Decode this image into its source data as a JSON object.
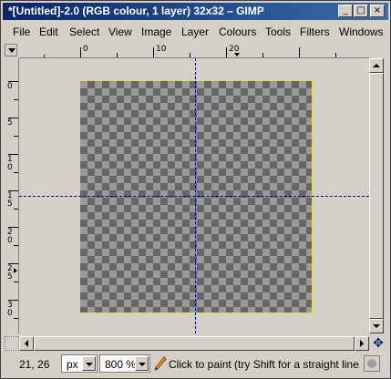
{
  "window": {
    "title": "*[Untitled]-2.0 (RGB colour, 1 layer) 32x32 – GIMP",
    "controls": {
      "minimize": "_",
      "maximize": "□",
      "close": "×"
    }
  },
  "menubar": {
    "items": [
      {
        "label": "File"
      },
      {
        "label": "Edit"
      },
      {
        "label": "Select"
      },
      {
        "label": "View"
      },
      {
        "label": "Image"
      },
      {
        "label": "Layer"
      },
      {
        "label": "Colours"
      },
      {
        "label": "Tools"
      },
      {
        "label": "Filters"
      },
      {
        "label": "Windows"
      }
    ]
  },
  "rulers": {
    "horizontal": [
      "0",
      "10",
      "20"
    ],
    "vertical": [
      "0",
      "5",
      "10",
      "15",
      "20",
      "25",
      "30"
    ]
  },
  "statusbar": {
    "coords": "21, 26",
    "unit": "px",
    "zoom": "800 %",
    "hint": "Click to paint (try Shift for a straight line, ..."
  },
  "icons": {
    "corner": "chevron-down-icon",
    "quickmask": "quick-mask-icon",
    "navigate": "navigate-icon",
    "tool": "pencil-icon",
    "cancel": "cancel-icon"
  }
}
